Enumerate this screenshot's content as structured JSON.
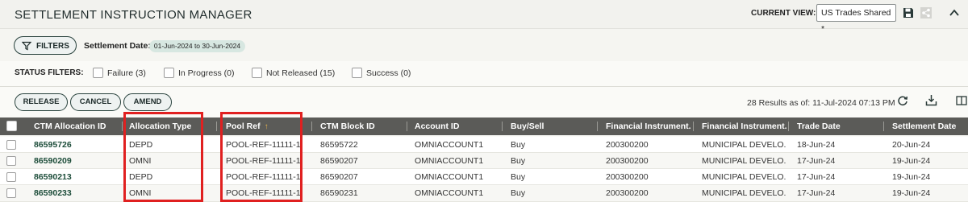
{
  "header": {
    "title": "SETTLEMENT INSTRUCTION MANAGER",
    "current_view_label": "CURRENT VIEW:",
    "current_view_value": "US Trades Shared *"
  },
  "filters": {
    "button_label": "FILTERS",
    "settlement_date_label": "Settlement Date:",
    "settlement_date_value": "01-Jun-2024 to 30-Jun-2024"
  },
  "status_filters": {
    "label": "STATUS FILTERS:",
    "items": [
      {
        "label": "Failure (3)",
        "checked": false
      },
      {
        "label": "In Progress (0)",
        "checked": false
      },
      {
        "label": "Not Released (15)",
        "checked": false
      },
      {
        "label": "Success (0)",
        "checked": false
      }
    ]
  },
  "actions": {
    "release": "RELEASE",
    "cancel": "CANCEL",
    "amend": "AMEND",
    "results_text": "28 Results as of: 11-Jul-2024 07:13 PM"
  },
  "grid": {
    "columns": [
      "CTM Allocation ID",
      "Allocation Type",
      "Pool Ref",
      "CTM Block ID",
      "Account ID",
      "Buy/Sell",
      "Financial Instrument...",
      "Financial Instrument...",
      "Trade Date",
      "Settlement Date"
    ],
    "sort_indicator": "↑",
    "rows": [
      [
        "86595726",
        "DEPD",
        "POOL-REF-11111-1",
        "86595722",
        "OMNIACCOUNT1",
        "Buy",
        "200300200",
        "MUNICIPAL DEVELO...",
        "18-Jun-24",
        "20-Jun-24"
      ],
      [
        "86590209",
        "OMNI",
        "POOL-REF-11111-1",
        "86590207",
        "OMNIACCOUNT1",
        "Buy",
        "200300200",
        "MUNICIPAL DEVELO...",
        "17-Jun-24",
        "19-Jun-24"
      ],
      [
        "86590213",
        "DEPD",
        "POOL-REF-11111-1",
        "86590207",
        "OMNIACCOUNT1",
        "Buy",
        "200300200",
        "MUNICIPAL DEVELO...",
        "17-Jun-24",
        "19-Jun-24"
      ],
      [
        "86590233",
        "OMNI",
        "POOL-REF-11111-1",
        "86590231",
        "OMNIACCOUNT1",
        "Buy",
        "200300200",
        "MUNICIPAL DEVELO...",
        "17-Jun-24",
        "19-Jun-24"
      ]
    ]
  },
  "colors": {
    "header_bg": "#5b5b58",
    "accent": "#28413c",
    "highlight": "#e02020",
    "link": "#1d4d3a"
  }
}
